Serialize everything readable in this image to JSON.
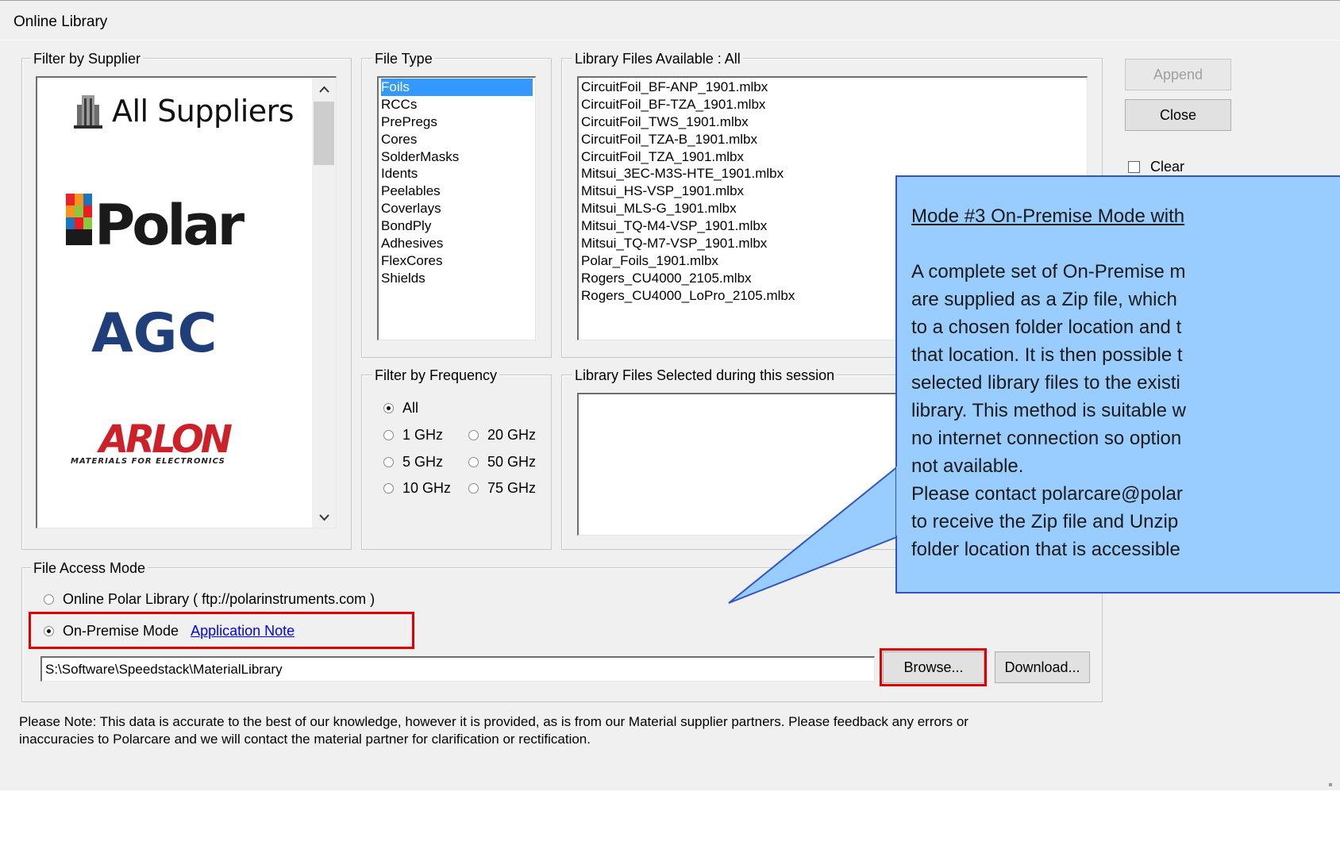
{
  "window": {
    "title": "Online Library"
  },
  "supplier": {
    "group_label": "Filter by Supplier",
    "logos": [
      "All Suppliers",
      "Polar",
      "AGC",
      "ARLON",
      "MATERIALS FOR ELECTRONICS"
    ]
  },
  "file_type": {
    "group_label": "File Type",
    "items": [
      "Foils",
      "RCCs",
      "PrePregs",
      "Cores",
      "SolderMasks",
      "Idents",
      "Peelables",
      "Coverlays",
      "BondPly",
      "Adhesives",
      "FlexCores",
      "Shields"
    ],
    "selected": "Foils"
  },
  "library_files": {
    "group_label": "Library Files Available : All",
    "items": [
      "CircuitFoil_BF-ANP_1901.mlbx",
      "CircuitFoil_BF-TZA_1901.mlbx",
      "CircuitFoil_TWS_1901.mlbx",
      "CircuitFoil_TZA-B_1901.mlbx",
      "CircuitFoil_TZA_1901.mlbx",
      "Mitsui_3EC-M3S-HTE_1901.mlbx",
      "Mitsui_HS-VSP_1901.mlbx",
      "Mitsui_MLS-G_1901.mlbx",
      "Mitsui_TQ-M4-VSP_1901.mlbx",
      "Mitsui_TQ-M7-VSP_1901.mlbx",
      "Polar_Foils_1901.mlbx",
      "Rogers_CU4000_2105.mlbx",
      "Rogers_CU4000_LoPro_2105.mlbx"
    ]
  },
  "frequency": {
    "group_label": "Filter by Frequency",
    "options": [
      "All",
      "1 GHz",
      "20 GHz",
      "5 GHz",
      "50 GHz",
      "10 GHz",
      "75 GHz"
    ],
    "selected": "All"
  },
  "selected_files": {
    "group_label": "Library Files Selected during this session"
  },
  "buttons": {
    "append": "Append",
    "close": "Close",
    "browse": "Browse...",
    "download": "Download..."
  },
  "clear_checkbox": {
    "label": "Clear",
    "checked": false
  },
  "access_mode": {
    "group_label": "File Access Mode",
    "online_label": "Online Polar Library ( ftp://polarinstruments.com )",
    "onpremise_label": "On-Premise Mode",
    "app_note_link": "Application Note",
    "selected": "On-Premise Mode",
    "path_value": "S:\\Software\\Speedstack\\MaterialLibrary"
  },
  "note": {
    "line1": "Please Note:  This data is accurate to the best of our knowledge, however it is provided, as is from our Material supplier partners.  Please feedback any errors or",
    "line2": "inaccuracies to Polarcare and we will contact the material partner for clarification or rectification."
  },
  "callout": {
    "heading": "Mode #3 On-Premise Mode with",
    "lines": [
      "A complete set of On-Premise m",
      "are supplied as a Zip file, which",
      "to a chosen folder location and t",
      "that location. It is then possible t",
      "selected library files to the existi",
      "library. This method is suitable w",
      "no internet connection so option",
      "not available.",
      "Please contact polarcare@polar",
      "to receive the Zip file and Unzip",
      "folder location that is accessible"
    ]
  },
  "colors": {
    "callout_fill": "#99ccff",
    "callout_border": "#2f55c4",
    "highlight_red": "#e00000",
    "selection_blue": "#3399ff",
    "link_blue": "#0000ff"
  }
}
